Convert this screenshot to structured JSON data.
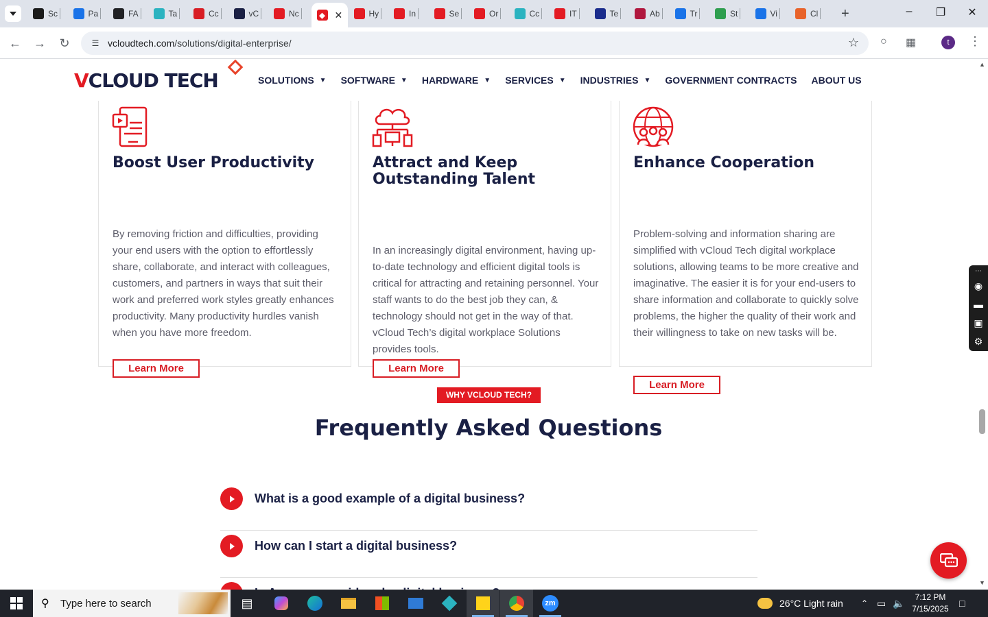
{
  "browser": {
    "tabs": [
      {
        "label": "Sc",
        "icon": "settings-tab-icon",
        "color": "#1a1a1a"
      },
      {
        "label": "Pa",
        "icon": "speed-tab-icon",
        "color": "#1a73e8"
      },
      {
        "label": "FA",
        "icon": "app-tab-icon",
        "color": "#202124"
      },
      {
        "label": "Ta",
        "icon": "app-tab-icon",
        "color": "#2bb3c0"
      },
      {
        "label": "Cc",
        "icon": "check-tab-icon",
        "color": "#d81d24"
      },
      {
        "label": "vC",
        "icon": "check-tab-icon",
        "color": "#1a2044"
      },
      {
        "label": "Nc",
        "icon": "tag-tab-icon",
        "color": "#e31b23"
      },
      {
        "label": "Hy",
        "icon": "tag-tab-icon",
        "color": "#e31b23"
      },
      {
        "label": "In",
        "icon": "tag-tab-icon",
        "color": "#e31b23"
      },
      {
        "label": "Se",
        "icon": "tag-tab-icon",
        "color": "#e31b23"
      },
      {
        "label": "Or",
        "icon": "tag-tab-icon",
        "color": "#e31b23"
      },
      {
        "label": "Cc",
        "icon": "app-tab-icon",
        "color": "#2bb3c0"
      },
      {
        "label": "IT",
        "icon": "tag-tab-icon",
        "color": "#e31b23"
      },
      {
        "label": "Te",
        "icon": "x-tab-icon",
        "color": "#1a2c8c"
      },
      {
        "label": "Ab",
        "icon": "app-tab-icon",
        "color": "#b0173e"
      },
      {
        "label": "Tr",
        "icon": "scale-tab-icon",
        "color": "#1a73e8"
      },
      {
        "label": "St",
        "icon": "pen-tab-icon",
        "color": "#2e9e4f"
      },
      {
        "label": "Vi",
        "icon": "pulse-tab-icon",
        "color": "#1a73e8"
      },
      {
        "label": "Cl",
        "icon": "claude-tab-icon",
        "color": "#e8632a"
      }
    ],
    "url_host": "vcloudtech.com",
    "url_path": "/solutions/digital-enterprise/",
    "profile_initial": "t"
  },
  "site": {
    "logo_text": "CLOUD TECH",
    "logo_v": "V",
    "nav": [
      {
        "label": "SOLUTIONS",
        "has_caret": true
      },
      {
        "label": "SOFTWARE",
        "has_caret": true
      },
      {
        "label": "HARDWARE",
        "has_caret": true
      },
      {
        "label": "SERVICES",
        "has_caret": true
      },
      {
        "label": "INDUSTRIES",
        "has_caret": true
      },
      {
        "label": "GOVERNMENT CONTRACTS",
        "has_caret": false
      },
      {
        "label": "ABOUT US",
        "has_caret": false
      }
    ]
  },
  "cards": [
    {
      "title": "Boost User Productivity",
      "icon": "tablet-icon",
      "body": "By removing friction and difficulties, providing your end users with the option to effortlessly share, collaborate, and interact with colleagues, customers, and partners in ways that suit their work and preferred work styles greatly enhances productivity. Many productivity hurdles vanish when you have more freedom.",
      "cta": "Learn More"
    },
    {
      "title": "Attract and Keep Outstanding Talent",
      "icon": "cloud-network-icon",
      "body": "In an increasingly digital environment, having up-to-date technology and efficient digital tools is critical for attracting and retaining personnel. Your staff wants to do the best job they can, & technology should not get in the way of that. vCloud Tech’s digital workplace Solutions provides tools.",
      "cta": "Learn More"
    },
    {
      "title": "Enhance Cooperation",
      "icon": "globe-people-icon",
      "body": "Problem-solving and information sharing are simplified with vCloud Tech digital workplace solutions, allowing teams to be more creative and imaginative. The easier it is for your end-users to share information and collaborate to quickly solve problems, the higher the quality of their work and their willingness to take on new tasks will be.",
      "cta": "Learn More"
    }
  ],
  "faq": {
    "badge": "WHY VCLOUD TECH?",
    "title": "Frequently Asked Questions",
    "items": [
      "What is a good example of a digital business?",
      "How can I start a digital business?",
      "Is Amazon considered a digital business?"
    ]
  },
  "taskbar": {
    "search_placeholder": "Type here to search",
    "weather": "26°C  Light rain",
    "time": "7:12 PM",
    "date": "7/15/2025"
  },
  "colors": {
    "brand_red": "#e31b23",
    "brand_navy": "#1a2044"
  }
}
